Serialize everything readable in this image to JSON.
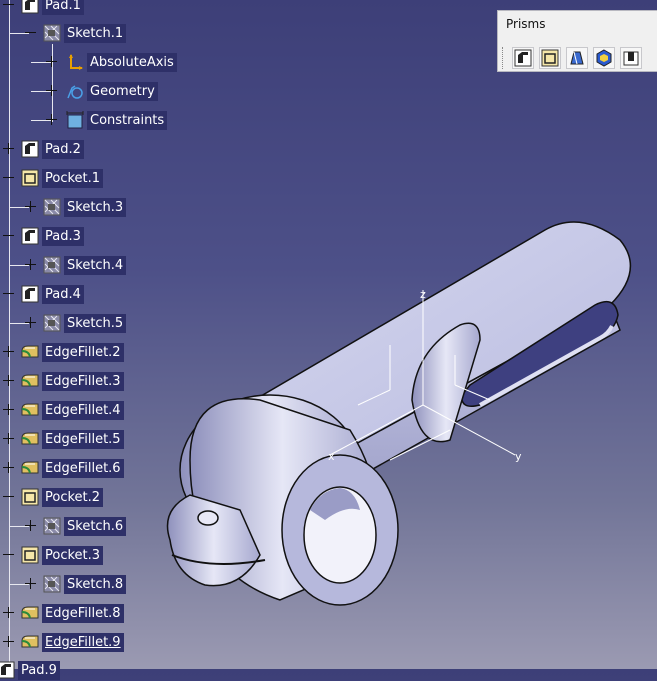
{
  "tree": {
    "items": [
      {
        "label": "Pad.1",
        "icon": "pad-icon"
      },
      {
        "label": "Sketch.1",
        "icon": "sketch-icon"
      },
      {
        "label": "AbsoluteAxis",
        "icon": "axis-icon"
      },
      {
        "label": "Geometry",
        "icon": "geometry-icon"
      },
      {
        "label": "Constraints",
        "icon": "constraints-icon"
      },
      {
        "label": "Pad.2",
        "icon": "pad-icon"
      },
      {
        "label": "Pocket.1",
        "icon": "pocket-icon"
      },
      {
        "label": "Sketch.3",
        "icon": "sketch-icon"
      },
      {
        "label": "Pad.3",
        "icon": "pad-icon"
      },
      {
        "label": "Sketch.4",
        "icon": "sketch-icon"
      },
      {
        "label": "Pad.4",
        "icon": "pad-icon"
      },
      {
        "label": "Sketch.5",
        "icon": "sketch-icon"
      },
      {
        "label": "EdgeFillet.2",
        "icon": "edgefillet-icon"
      },
      {
        "label": "EdgeFillet.3",
        "icon": "edgefillet-icon"
      },
      {
        "label": "EdgeFillet.4",
        "icon": "edgefillet-icon"
      },
      {
        "label": "EdgeFillet.5",
        "icon": "edgefillet-icon"
      },
      {
        "label": "EdgeFillet.6",
        "icon": "edgefillet-icon"
      },
      {
        "label": "Pocket.2",
        "icon": "pocket-icon"
      },
      {
        "label": "Sketch.6",
        "icon": "sketch-icon"
      },
      {
        "label": "Pocket.3",
        "icon": "pocket-icon"
      },
      {
        "label": "Sketch.8",
        "icon": "sketch-icon"
      },
      {
        "label": "EdgeFillet.8",
        "icon": "edgefillet-icon"
      },
      {
        "label": "EdgeFillet.9",
        "icon": "edgefillet-icon"
      },
      {
        "label": "Pad.9",
        "icon": "pad-icon"
      }
    ]
  },
  "toolbar": {
    "title": "Prisms",
    "buttons": [
      "pad-icon",
      "pocket-icon",
      "shaft-icon",
      "groove-icon",
      "hole-icon"
    ]
  },
  "axis_labels": {
    "x": "x",
    "y": "y",
    "z": "z"
  },
  "colors": {
    "background_top": "#3d3f78",
    "background_bottom": "#9b9ab2",
    "part": "#c4c6e6",
    "label_bg": "#2e3068"
  }
}
